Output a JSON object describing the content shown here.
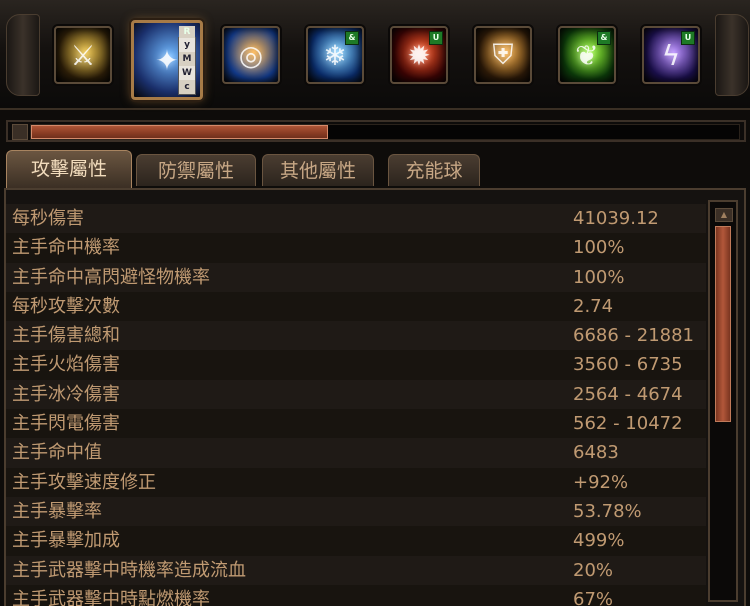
{
  "skills": [
    {
      "name": "sword-skill",
      "color1": "#f2c94c",
      "color2": "#2b1d08",
      "glyph": "⚔",
      "badge": ""
    },
    {
      "name": "selected-skill",
      "color1": "#6fb8ff",
      "color2": "#1a2f6b",
      "glyph": "✦",
      "badge": "",
      "runes": [
        "R",
        "y",
        "M",
        "W",
        "c"
      ]
    },
    {
      "name": "orb-skill",
      "color1": "#ffb347",
      "color2": "#123a8a",
      "glyph": "◎",
      "badge": ""
    },
    {
      "name": "frost-skill",
      "color1": "#7fd0ff",
      "color2": "#0a2c6a",
      "glyph": "❄",
      "badge": "&"
    },
    {
      "name": "fire-skill",
      "color1": "#ff5a2a",
      "color2": "#3a0404",
      "glyph": "✹",
      "badge": "U"
    },
    {
      "name": "armor-skill",
      "color1": "#ffb347",
      "color2": "#2b1908",
      "glyph": "⛨",
      "badge": ""
    },
    {
      "name": "nature-skill",
      "color1": "#9cff3a",
      "color2": "#0c3a0a",
      "glyph": "❦",
      "badge": "&"
    },
    {
      "name": "lightning-skill",
      "color1": "#b88cff",
      "color2": "#1a0f4a",
      "glyph": "ϟ",
      "badge": "U"
    }
  ],
  "experience": {
    "fill_percent": 42
  },
  "tabs": [
    {
      "label": "攻擊屬性",
      "active": true
    },
    {
      "label": "防禦屬性",
      "active": false
    },
    {
      "label": "其他屬性",
      "active": false
    },
    {
      "label": "充能球",
      "active": false
    }
  ],
  "stats": [
    {
      "label": "每秒傷害",
      "value": "41039.12"
    },
    {
      "label": "主手命中機率",
      "value": "100%"
    },
    {
      "label": "主手命中高閃避怪物機率",
      "value": "100%"
    },
    {
      "label": "每秒攻擊次數",
      "value": "2.74"
    },
    {
      "label": "主手傷害總和",
      "value": "6686 - 21881"
    },
    {
      "label": "主手火焰傷害",
      "value": "3560 - 6735"
    },
    {
      "label": "主手冰冷傷害",
      "value": "2564 - 4674"
    },
    {
      "label": "主手閃電傷害",
      "value": "562 - 10472"
    },
    {
      "label": "主手命中值",
      "value": "6483"
    },
    {
      "label": "主手攻擊速度修正",
      "value": "+92%"
    },
    {
      "label": "主手暴擊率",
      "value": "53.78%"
    },
    {
      "label": "主手暴擊加成",
      "value": "499%"
    },
    {
      "label": "主手武器擊中時機率造成流血",
      "value": "20%"
    },
    {
      "label": "主手武器擊中時點燃機率",
      "value": "67%"
    }
  ],
  "scrollbar": {
    "up_icon": "▲",
    "down_icon": "▼"
  }
}
